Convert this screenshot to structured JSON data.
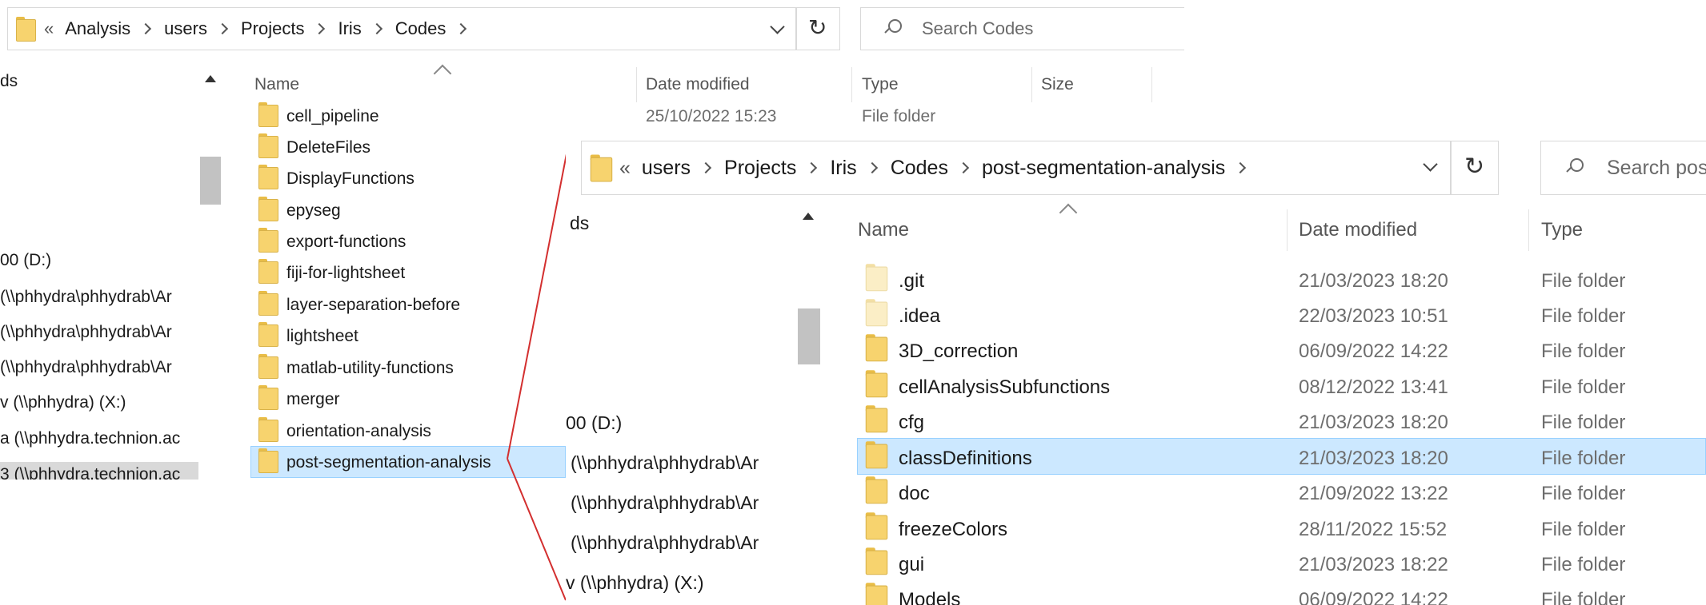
{
  "window1": {
    "breadcrumb": {
      "overflow": "«",
      "items": [
        "Analysis",
        "users",
        "Projects",
        "Iris",
        "Codes"
      ]
    },
    "search_placeholder": "Search Codes",
    "nav_pane": {
      "items": [
        "ds",
        "00 (D:)",
        "(\\\\phhydra\\phhydrab\\Ar",
        "(\\\\phhydra\\phhydrab\\Ar",
        "(\\\\phhydra\\phhydrab\\Ar",
        "v (\\\\phhydra) (X:)",
        "a (\\\\phhydra.technion.ac",
        "3 (\\\\phhydra.technion.ac"
      ]
    },
    "columns": [
      "Name",
      "Date modified",
      "Type",
      "Size"
    ],
    "rows": [
      {
        "name": "cell_pipeline",
        "date": "25/10/2022 15:23",
        "type": "File folder"
      },
      {
        "name": "DeleteFiles",
        "date": "",
        "type": ""
      },
      {
        "name": "DisplayFunctions",
        "date": "",
        "type": ""
      },
      {
        "name": "epyseg",
        "date": "",
        "type": ""
      },
      {
        "name": "export-functions",
        "date": "",
        "type": ""
      },
      {
        "name": "fiji-for-lightsheet",
        "date": "",
        "type": ""
      },
      {
        "name": "layer-separation-before",
        "date": "",
        "type": ""
      },
      {
        "name": "lightsheet",
        "date": "",
        "type": ""
      },
      {
        "name": "matlab-utility-functions",
        "date": "",
        "type": ""
      },
      {
        "name": "merger",
        "date": "",
        "type": ""
      },
      {
        "name": "orientation-analysis",
        "date": "",
        "type": ""
      },
      {
        "name": "post-segmentation-analysis",
        "date": "",
        "type": "",
        "selected": true
      }
    ]
  },
  "window2": {
    "breadcrumb": {
      "overflow": "«",
      "items": [
        "users",
        "Projects",
        "Iris",
        "Codes",
        "post-segmentation-analysis"
      ]
    },
    "search_placeholder": "Search pos",
    "nav_pane": {
      "items": [
        "ds",
        "00 (D:)",
        "(\\\\phhydra\\phhydrab\\Ar",
        "(\\\\phhydra\\phhydrab\\Ar",
        "(\\\\phhydra\\phhydrab\\Ar",
        "v (\\\\phhydra) (X:)"
      ]
    },
    "columns": [
      "Name",
      "Date modified",
      "Type"
    ],
    "rows": [
      {
        "name": ".git",
        "date": "21/03/2023 18:20",
        "type": "File folder",
        "hidden": true
      },
      {
        "name": ".idea",
        "date": "22/03/2023 10:51",
        "type": "File folder",
        "hidden": true
      },
      {
        "name": "3D_correction",
        "date": "06/09/2022 14:22",
        "type": "File folder"
      },
      {
        "name": "cellAnalysisSubfunctions",
        "date": "08/12/2022 13:41",
        "type": "File folder"
      },
      {
        "name": "cfg",
        "date": "21/03/2023 18:20",
        "type": "File folder"
      },
      {
        "name": "classDefinitions",
        "date": "21/03/2023 18:20",
        "type": "File folder",
        "selected": true
      },
      {
        "name": "doc",
        "date": "21/09/2022 13:22",
        "type": "File folder"
      },
      {
        "name": "freezeColors",
        "date": "28/11/2022 15:52",
        "type": "File folder"
      },
      {
        "name": "gui",
        "date": "21/03/2023 18:22",
        "type": "File folder"
      },
      {
        "name": "Models",
        "date": "06/09/2022 14:22",
        "type": "File folder"
      }
    ]
  },
  "colors": {
    "folder": "#f7d36e",
    "selection_fill": "#cce8ff",
    "selection_border": "#99d1ff",
    "callout_line": "#d32f2f"
  },
  "icons": [
    "folder-icon",
    "chevron-right-icon",
    "chevron-down-icon",
    "refresh-icon",
    "search-icon",
    "scroll-up-icon",
    "sort-caret-icon"
  ]
}
